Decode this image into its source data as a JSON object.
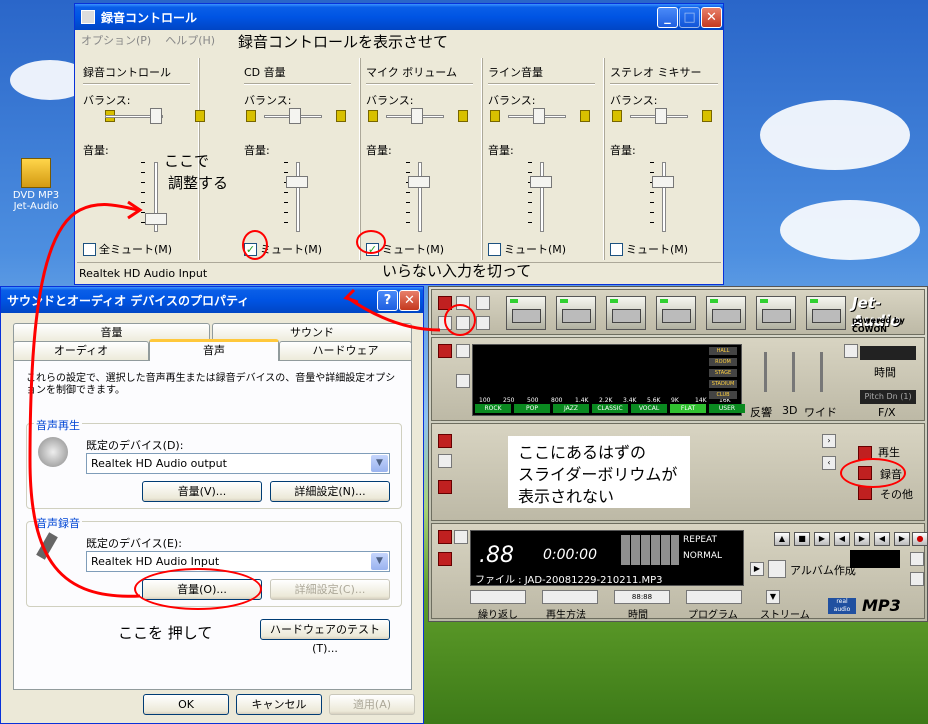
{
  "desktop": {
    "icon_label_1": "DVD MP3",
    "icon_label_2": "Jet-Audio"
  },
  "rec_window": {
    "title": "録音コントロール",
    "menu": [
      "オプション(P)",
      "ヘルプ(H)"
    ],
    "status": "Realtek HD Audio Input",
    "columns": [
      {
        "header": "録音コントロール",
        "balance": "バランス:",
        "volume": "音量:",
        "mute": "全ミュート(M)",
        "checked": false
      },
      {
        "header": "CD 音量",
        "balance": "バランス:",
        "volume": "音量:",
        "mute": "ミュート(M)",
        "checked": true
      },
      {
        "header": "マイク ボリューム",
        "balance": "バランス:",
        "volume": "音量:",
        "mute": "ミュート(M)",
        "checked": true
      },
      {
        "header": "ライン音量",
        "balance": "バランス:",
        "volume": "音量:",
        "mute": "ミュート(M)",
        "checked": false
      },
      {
        "header": "ステレオ ミキサー",
        "balance": "バランス:",
        "volume": "音量:",
        "mute": "ミュート(M)",
        "checked": false
      }
    ]
  },
  "sound_dialog": {
    "title": "サウンドとオーディオ デバイスのプロパティ",
    "tabs_row1": [
      "音量",
      "サウンド"
    ],
    "tabs_row2": [
      "オーディオ",
      "音声",
      "ハードウェア"
    ],
    "description": "これらの設定で、選択した音声再生または録音デバイスの、音量や詳細設定オプションを制御できます。",
    "playback": {
      "label": "音声再生",
      "default_label": "既定のデバイス(D):",
      "device": "Realtek HD Audio output",
      "volume_btn": "音量(V)...",
      "advanced_btn": "詳細設定(N)..."
    },
    "recording": {
      "label": "音声録音",
      "default_label": "既定のデバイス(E):",
      "device": "Realtek HD Audio Input",
      "volume_btn": "音量(O)...",
      "advanced_btn": "詳細設定(C)..."
    },
    "hw_test_btn": "ハードウェアのテスト(T)...",
    "ok": "OK",
    "cancel": "キャンセル",
    "apply": "適用(A)"
  },
  "jetaudio": {
    "logo": "Jet-Audio",
    "powered": "powered by COWON",
    "eq_freqs": [
      "100",
      "250",
      "500",
      "800",
      "1.4K",
      "2.2K",
      "3.4K",
      "5.6K",
      "9K",
      "14K",
      "16K"
    ],
    "eq_presets": [
      "ROCK",
      "POP",
      "JAZZ",
      "CLASSIC",
      "VOCAL",
      "FLAT",
      "USER"
    ],
    "eq_modes": [
      "HALL",
      "ROOM",
      "STAGE",
      "STADIUM",
      "CLUB"
    ],
    "effect_labels": [
      "反響",
      "3D",
      "ワイド"
    ],
    "time_label": "時間",
    "pitch": "Pitch Dn (1)",
    "fx": "F/X",
    "play_label": "再生",
    "rec_label": "録音",
    "other_label": "その他",
    "track": ".88",
    "time": "0:00:00",
    "file": "ファイル : JAD-20081229-210211.MP3",
    "repeat": "REPEAT",
    "normal": "NORMAL",
    "album": "アルバム作成",
    "bottom_labels": [
      "繰り返し",
      "再生方法",
      "時間",
      "プログラム",
      "ストリーム"
    ],
    "time_display": "88:88",
    "format": "MP3",
    "real": "real audio"
  },
  "annotations": {
    "show_rec": "録音コントロールを表示させて",
    "adjust_here_1": "ここで",
    "adjust_here_2": "調整する",
    "cut_inputs": "いらない入力を切って",
    "press_here": "ここを 押して",
    "note_1": "ここにあるはずの",
    "note_2": "スライダーボリウムが",
    "note_3": "表示されない"
  }
}
